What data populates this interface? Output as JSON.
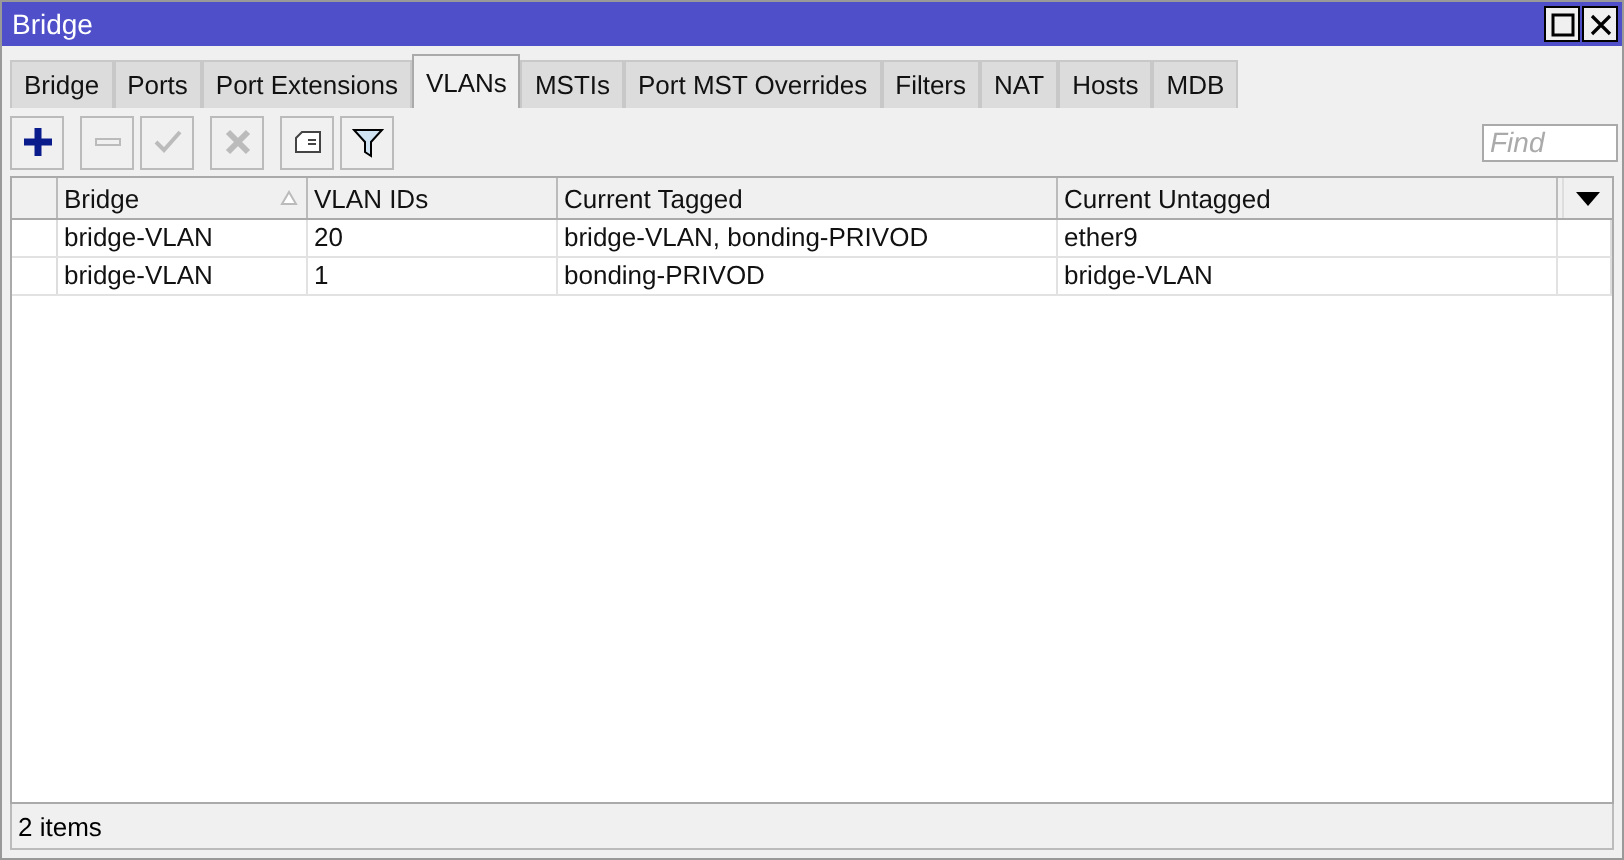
{
  "window": {
    "title": "Bridge"
  },
  "tabs": [
    {
      "label": "Bridge",
      "selected": false
    },
    {
      "label": "Ports",
      "selected": false
    },
    {
      "label": "Port Extensions",
      "selected": false
    },
    {
      "label": "VLANs",
      "selected": true
    },
    {
      "label": "MSTIs",
      "selected": false
    },
    {
      "label": "Port MST Overrides",
      "selected": false
    },
    {
      "label": "Filters",
      "selected": false
    },
    {
      "label": "NAT",
      "selected": false
    },
    {
      "label": "Hosts",
      "selected": false
    },
    {
      "label": "MDB",
      "selected": false
    }
  ],
  "toolbar": [
    {
      "kind": "add",
      "disabled": false
    },
    {
      "kind": "remove",
      "disabled": true
    },
    {
      "kind": "enable",
      "disabled": true
    },
    {
      "kind": "disable",
      "disabled": true
    },
    {
      "kind": "comment",
      "disabled": false
    },
    {
      "kind": "filter",
      "disabled": false
    }
  ],
  "search": {
    "placeholder": "Find"
  },
  "table": {
    "columns": [
      {
        "label": "Bridge",
        "sorted": true
      },
      {
        "label": "VLAN IDs",
        "sorted": false
      },
      {
        "label": "Current Tagged",
        "sorted": false
      },
      {
        "label": "Current Untagged",
        "sorted": false
      }
    ],
    "rows": [
      [
        "bridge-VLAN",
        "20",
        "bridge-VLAN, bonding-PRIVOD",
        "ether9"
      ],
      [
        "bridge-VLAN",
        "1",
        "bonding-PRIVOD",
        "bridge-VLAN"
      ]
    ]
  },
  "status_bar": "2 items"
}
